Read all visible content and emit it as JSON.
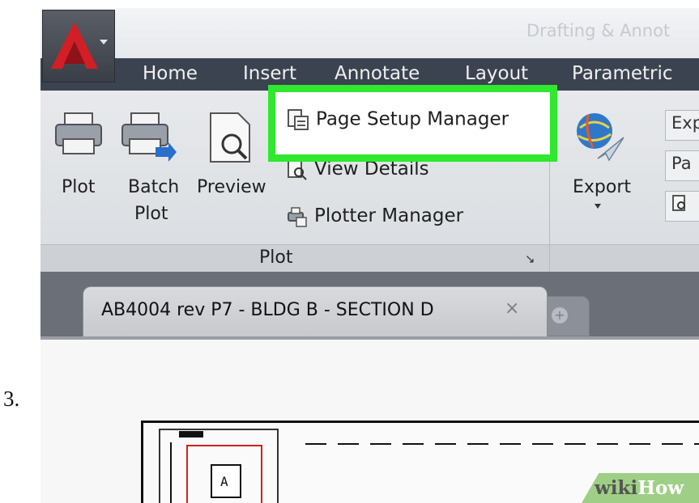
{
  "step_number": "3.",
  "window": {
    "title": "Drafting & Annot"
  },
  "ribbon_tabs": [
    "Home",
    "Insert",
    "Annotate",
    "Layout",
    "Parametric"
  ],
  "plot_panel": {
    "label": "Plot",
    "plot_button": "Plot",
    "batch_plot_line1": "Batch",
    "batch_plot_line2": "Plot",
    "preview_button": "Preview",
    "page_setup_manager": "Page Setup Manager",
    "view_details": "View Details",
    "plotter_manager": "Plotter Manager"
  },
  "export_panel": {
    "export_button": "Export",
    "right_items": [
      "Exp",
      "Pa",
      ""
    ]
  },
  "file_tab": {
    "label": "AB4004 rev P7 - BLDG B - SECTION D",
    "close": "×"
  },
  "watermark": {
    "part1": "wiki",
    "part2": "How"
  },
  "colors": {
    "highlight": "#2fe82f",
    "ribbon_bg": "#e3e5e8",
    "tab_bar_bg": "#3c4350",
    "autocad_red": "#d21f26"
  }
}
